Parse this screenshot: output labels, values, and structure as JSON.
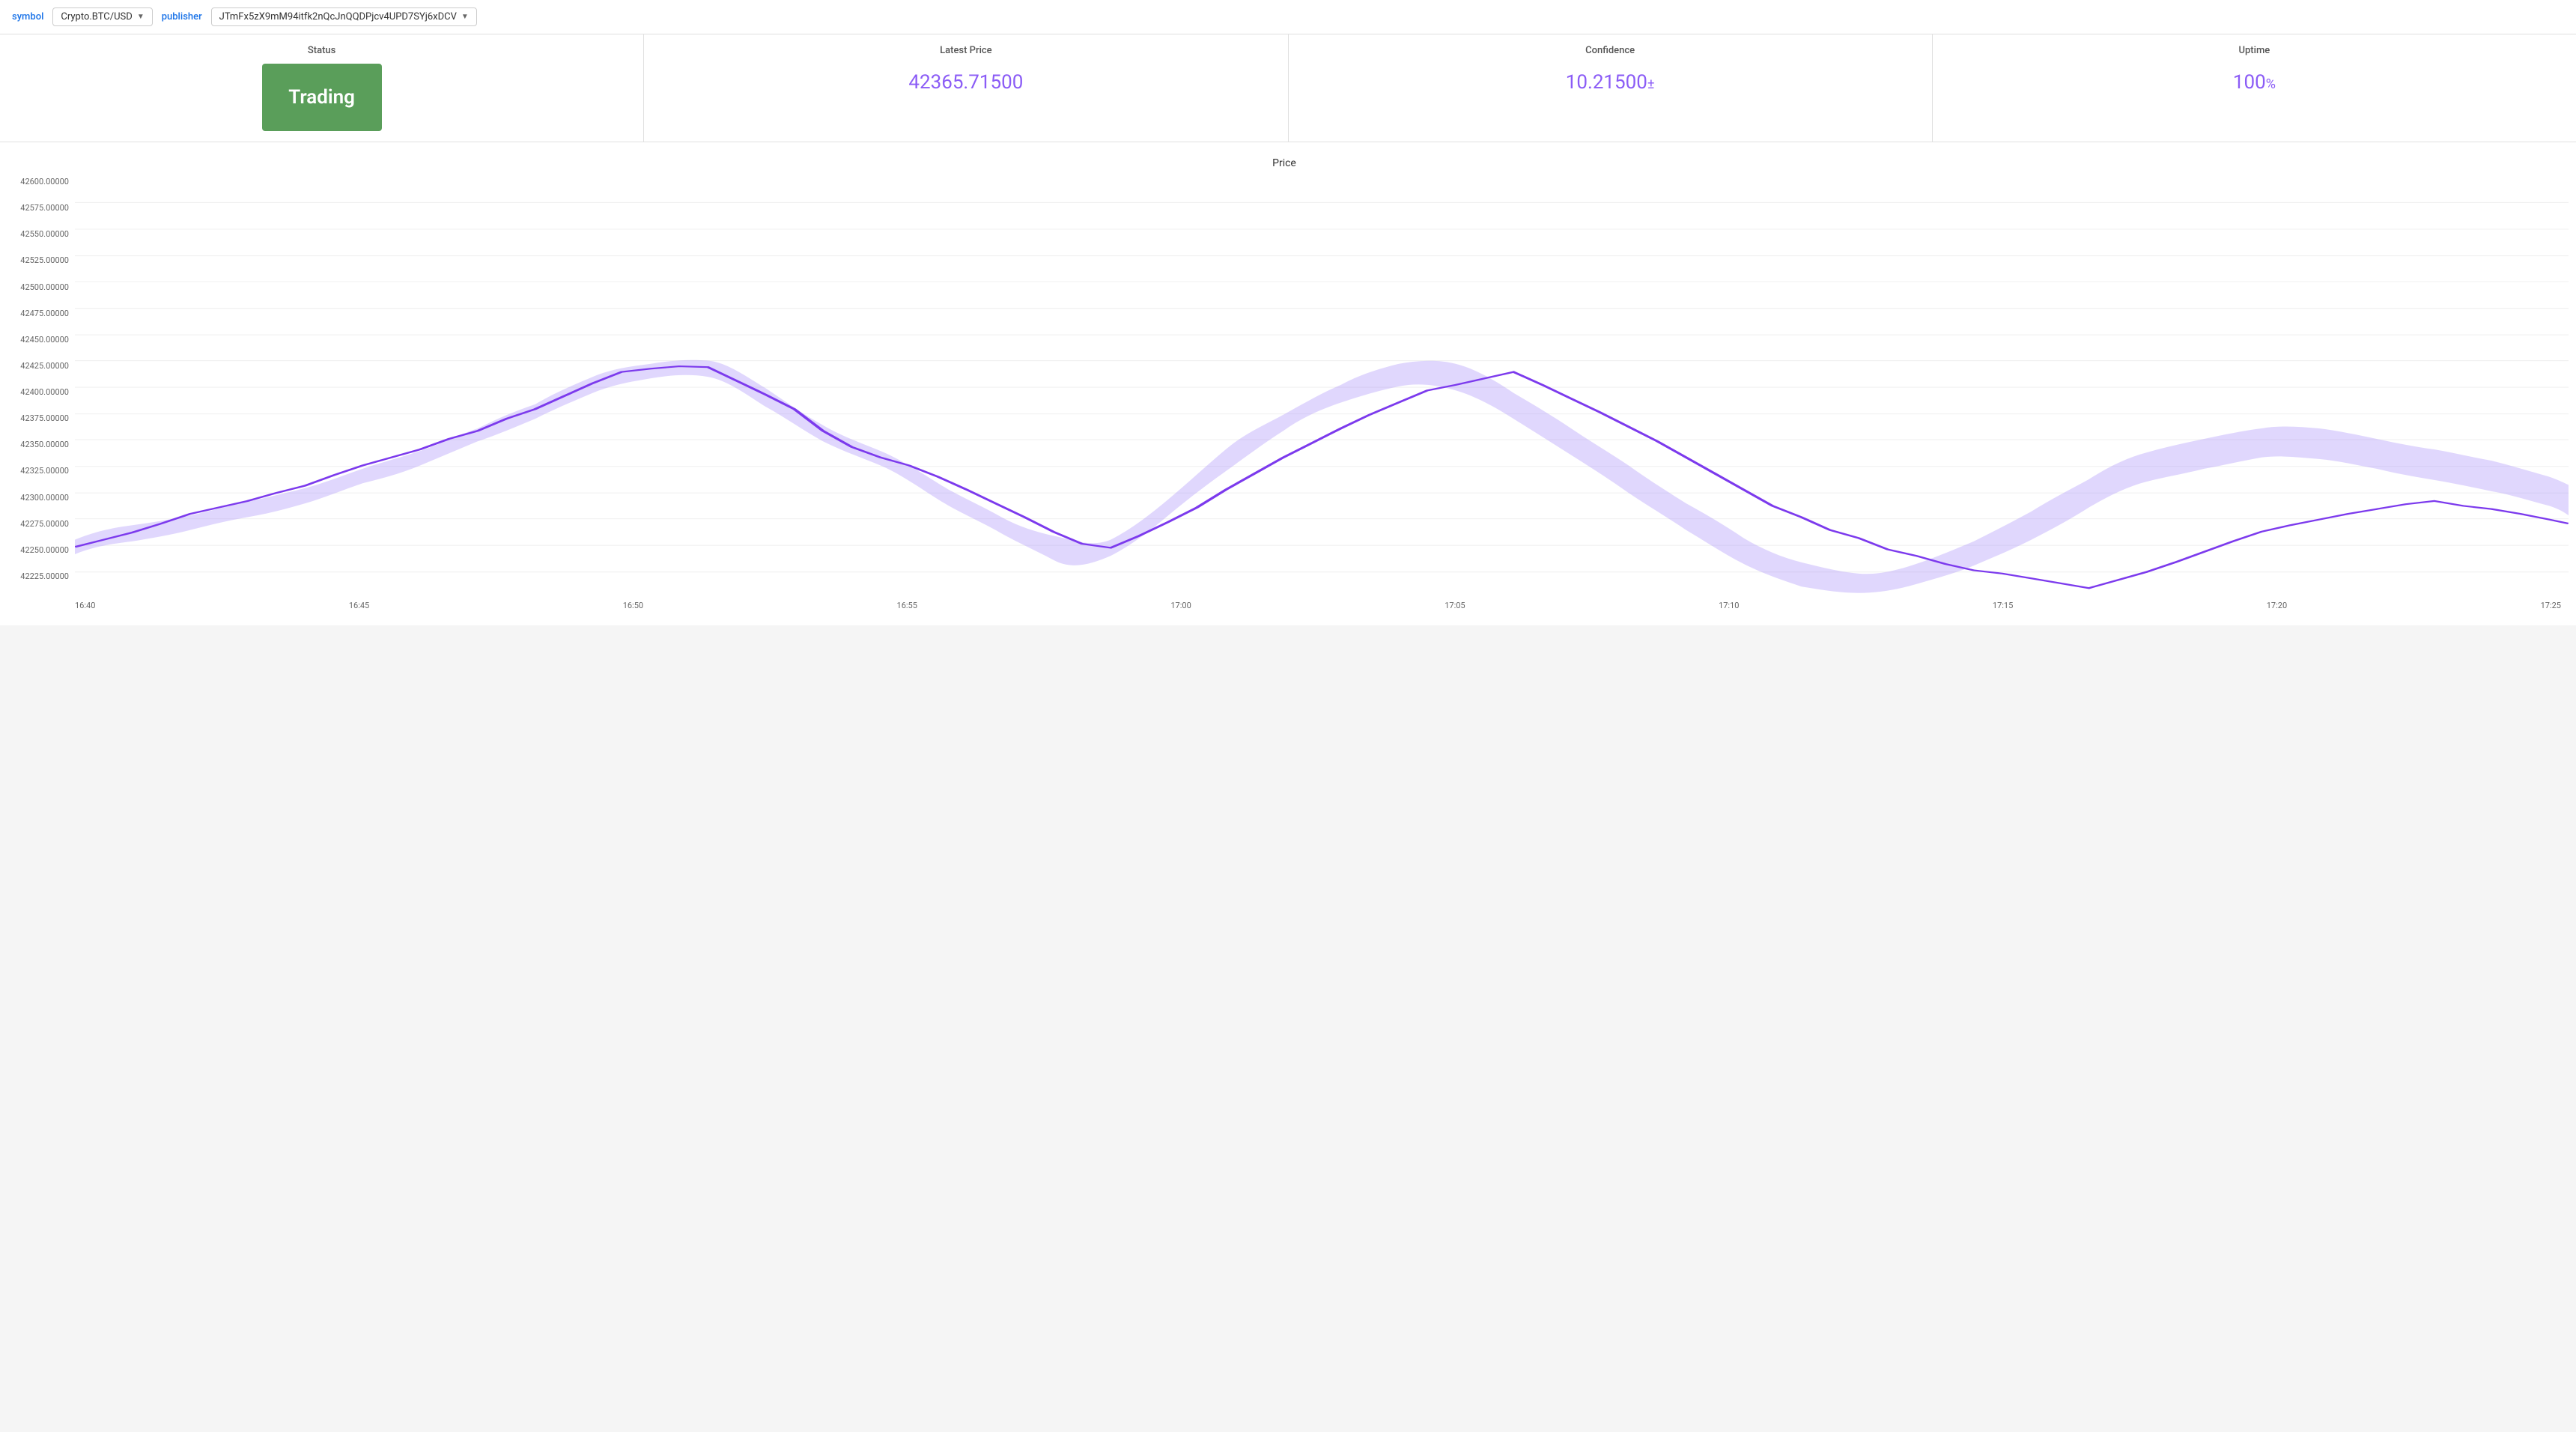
{
  "topbar": {
    "symbol_label": "symbol",
    "symbol_value": "Crypto.BTC/USD",
    "publisher_label": "publisher",
    "publisher_value": "JTmFx5zX9mM94itfk2nQcJnQQDPjcv4UPD7SYj6xDCV"
  },
  "stats": {
    "status_label": "Status",
    "status_value": "Trading",
    "price_label": "Latest Price",
    "price_value": "42365.71500",
    "confidence_label": "Confidence",
    "confidence_value": "10.21500",
    "confidence_pm": "±",
    "uptime_label": "Uptime",
    "uptime_value": "100",
    "uptime_unit": "%"
  },
  "chart": {
    "title": "Price",
    "y_labels": [
      "42600.00000",
      "42575.00000",
      "42550.00000",
      "42525.00000",
      "42500.00000",
      "42475.00000",
      "42450.00000",
      "42425.00000",
      "42400.00000",
      "42375.00000",
      "42350.00000",
      "42325.00000",
      "42300.00000",
      "42275.00000",
      "42250.00000",
      "42225.00000"
    ],
    "x_labels": [
      "16:40",
      "16:45",
      "16:50",
      "16:55",
      "17:00",
      "17:05",
      "17:10",
      "17:15",
      "17:20",
      "17:25"
    ],
    "colors": {
      "line": "#7c3aed",
      "band": "rgba(167, 139, 250, 0.35)",
      "accent": "#8b5cf6"
    }
  }
}
